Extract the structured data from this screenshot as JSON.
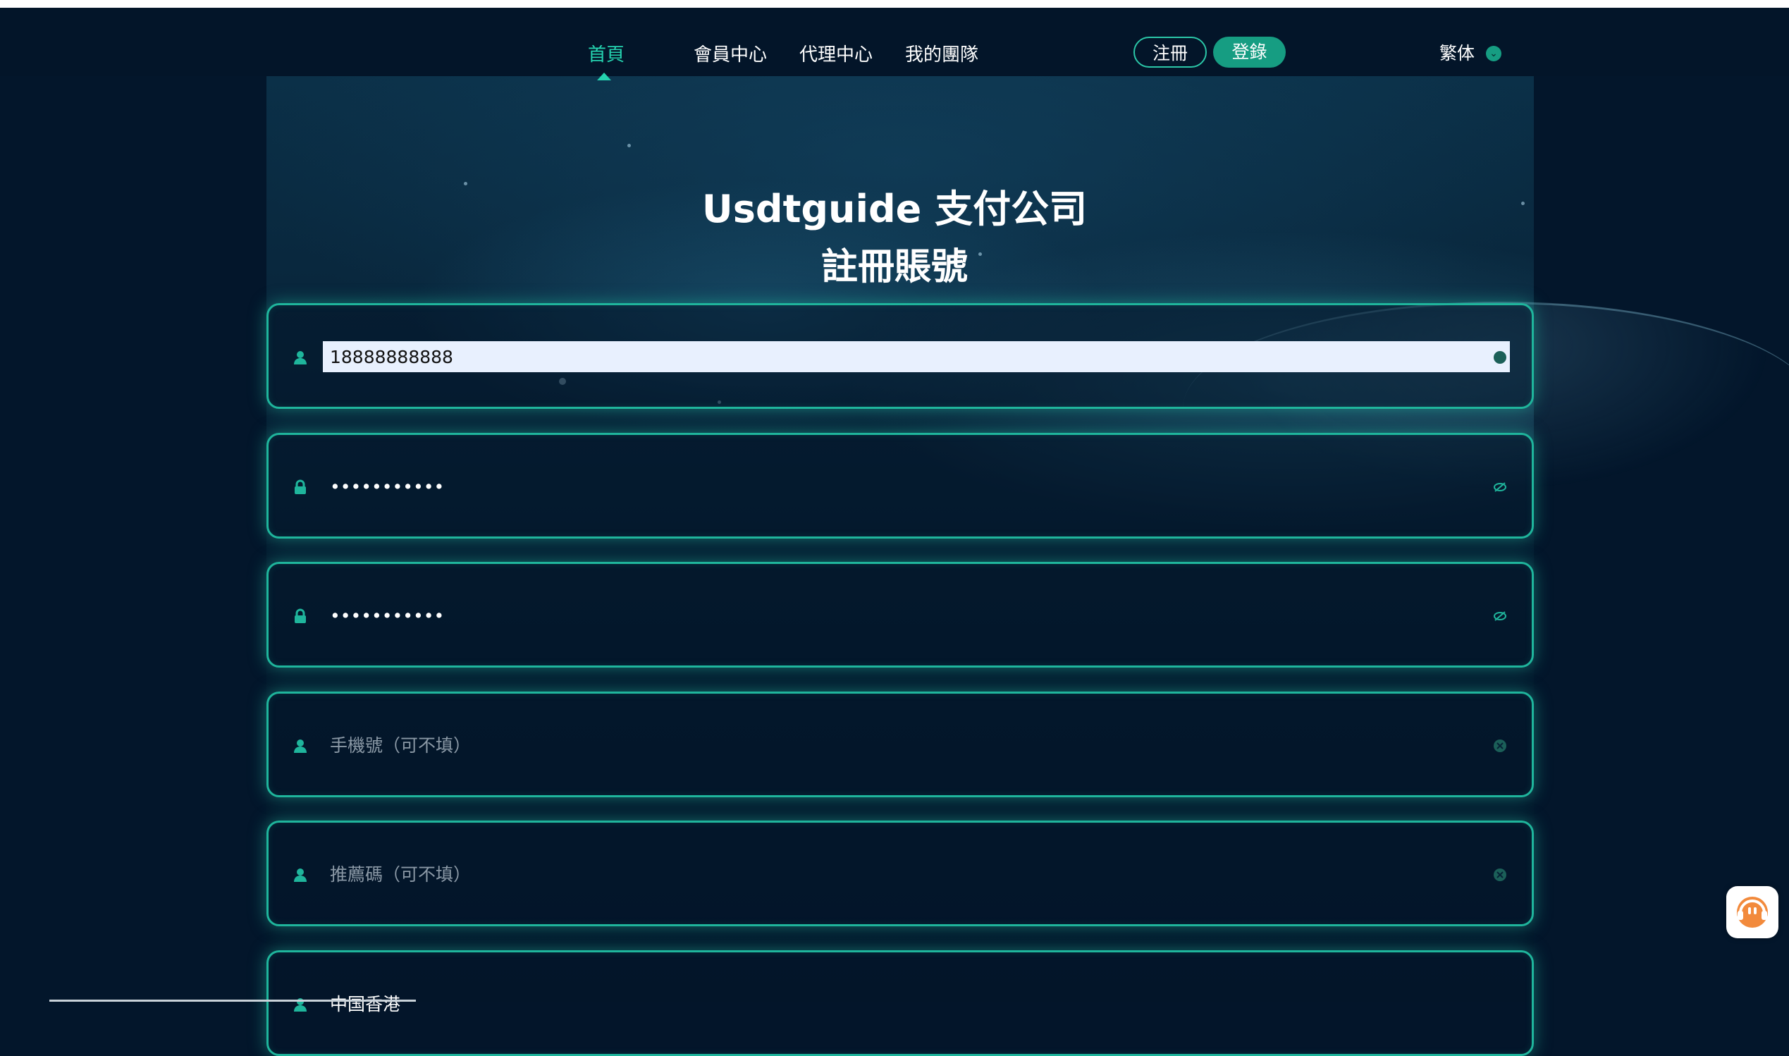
{
  "nav": {
    "items": [
      {
        "label": "首頁",
        "active": true
      },
      {
        "label": "會員中心",
        "active": false
      },
      {
        "label": "代理中心",
        "active": false
      },
      {
        "label": "我的團隊",
        "active": false
      }
    ],
    "register_label": "注冊",
    "login_label": "登錄",
    "language_label": "繁体",
    "language_icon": "chevron-down-icon"
  },
  "hero": {
    "title": "Usdtguide 支付公司",
    "subtitle": "註冊賬號"
  },
  "form": {
    "username": {
      "value": "18888888888",
      "icon": "user-icon",
      "action_icon": "clear-icon"
    },
    "password": {
      "value": "•••••••••••",
      "icon": "lock-icon",
      "action_icon": "eye-off-icon"
    },
    "confirm_password": {
      "value": "•••••••••••",
      "icon": "lock-icon",
      "action_icon": "eye-off-icon"
    },
    "phone": {
      "placeholder": "手機號（可不填）",
      "icon": "user-icon",
      "action_icon": "clear-icon"
    },
    "referral": {
      "placeholder": "推薦碼（可不填）",
      "icon": "user-icon",
      "action_icon": "clear-icon"
    },
    "region": {
      "value": "中国香港",
      "icon": "user-icon"
    }
  },
  "support": {
    "icon": "customer-service-icon"
  },
  "colors": {
    "accent": "#25d3b0",
    "button": "#169d82",
    "border": "#1fb59c",
    "background": "#03162b"
  }
}
